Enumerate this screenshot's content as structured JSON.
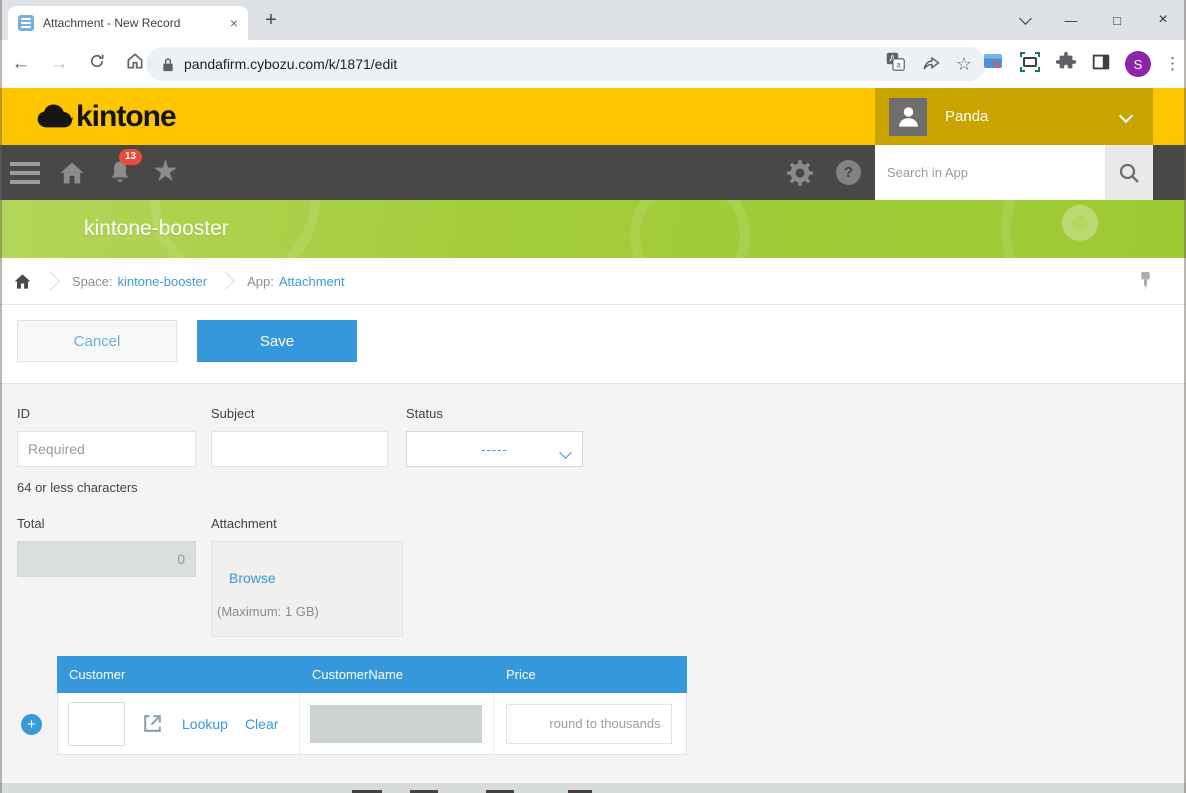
{
  "browser": {
    "tab_title": "Attachment - New Record",
    "url": "pandafirm.cybozu.com/k/1871/edit",
    "profile_initial": "S"
  },
  "icons": {
    "back": "←",
    "forward": "→",
    "new_tab": "+",
    "tab_close": "×",
    "window_minimize": "—",
    "window_maximize": "□",
    "window_close": "×",
    "bookmark_star": "☆",
    "overflow_menu": "⋮",
    "nav_star": "★",
    "help": "?",
    "add_row": "+"
  },
  "header": {
    "logo_text": "kintone",
    "user_name": "Panda"
  },
  "navbar": {
    "notification_count": "13",
    "search_placeholder": "Search in App"
  },
  "banner": {
    "title": "kintone-booster"
  },
  "breadcrumb": {
    "space_prefix": "Space:",
    "space_link": "kintone-booster",
    "app_prefix": "App:",
    "app_link": "Attachment"
  },
  "actions": {
    "cancel_label": "Cancel",
    "save_label": "Save"
  },
  "form": {
    "id": {
      "label": "ID",
      "placeholder": "Required",
      "hint": "64 or less characters"
    },
    "subject": {
      "label": "Subject"
    },
    "status": {
      "label": "Status",
      "value": "-----"
    },
    "total": {
      "label": "Total",
      "value": "0"
    },
    "attachment": {
      "label": "Attachment",
      "browse_label": "Browse",
      "max_note": "(Maximum: 1 GB)"
    }
  },
  "table": {
    "columns": [
      "Customer",
      "CustomerName",
      "Price"
    ],
    "row": {
      "lookup_label": "Lookup",
      "clear_label": "Clear",
      "price_placeholder": "round to thousands"
    }
  },
  "colors": {
    "accent_blue": "#3498db",
    "header_yellow": "#fdc600",
    "user_panel_gold": "#c9a300",
    "nav_gray": "#4a4846",
    "banner_green": "#a3cd3c",
    "badge_red": "#e74c3c",
    "link_blue": "#3f9bd8"
  }
}
